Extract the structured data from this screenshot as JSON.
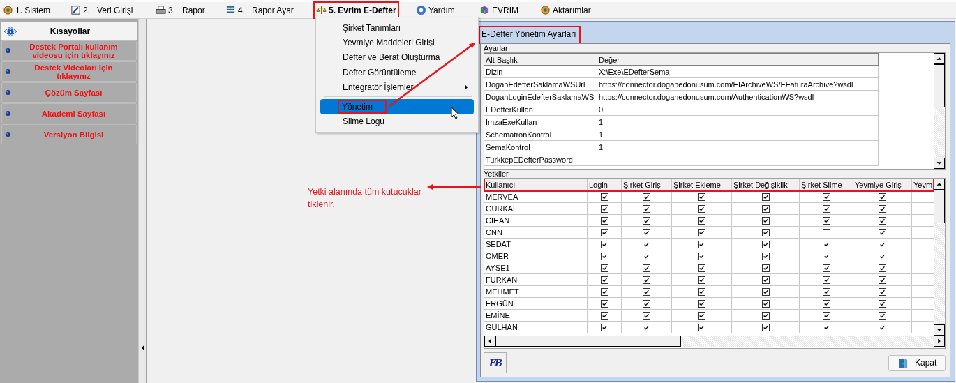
{
  "menu_bar": [
    {
      "label": "1. Sistem",
      "selected": false,
      "highlighted": false
    },
    {
      "label": "2.   Veri Girişi",
      "selected": false,
      "highlighted": false
    },
    {
      "label": "3.   Rapor",
      "selected": false,
      "highlighted": false
    },
    {
      "label": "4.   Rapor Ayar",
      "selected": false,
      "highlighted": false
    },
    {
      "label": "5. Evrim E-Defter",
      "selected": true,
      "highlighted": true
    },
    {
      "label": "Yardım",
      "selected": false,
      "highlighted": false
    },
    {
      "label": "EVRIM",
      "selected": false,
      "highlighted": false
    },
    {
      "label": "Aktarımlar",
      "selected": false,
      "highlighted": false
    }
  ],
  "dropdown": [
    {
      "kind": "item",
      "label": "Şirket Tanımları",
      "selected": false,
      "submenu": false,
      "highlighted": false
    },
    {
      "kind": "item",
      "label": "Yevmiye Maddeleri Girişi",
      "selected": false,
      "submenu": false,
      "highlighted": false
    },
    {
      "kind": "item",
      "label": "Defter ve Berat Oluşturma",
      "selected": false,
      "submenu": false,
      "highlighted": false
    },
    {
      "kind": "item",
      "label": "Defter Görüntüleme",
      "selected": false,
      "submenu": false,
      "highlighted": false
    },
    {
      "kind": "item",
      "label": "Entegratör İşlemleri",
      "selected": false,
      "submenu": true,
      "highlighted": false
    },
    {
      "kind": "separator"
    },
    {
      "kind": "item",
      "label": "Yönetim",
      "selected": true,
      "submenu": false,
      "highlighted": true
    },
    {
      "kind": "item",
      "label": "Silme Logu",
      "selected": false,
      "submenu": false,
      "highlighted": false
    }
  ],
  "sidebar": {
    "title": "Kısayollar",
    "items": [
      "Destek Portalı kullanım videosu için tıklayınız",
      "Destek Videoları için tıklayınız",
      "Çözüm Sayfası",
      "Akademi Sayfası",
      "Versiyon Bilgisi"
    ]
  },
  "dialog": {
    "title": "E-Defter Yönetim Ayarları",
    "title_highlighted": true,
    "settings": {
      "label": "Ayarlar",
      "columns": [
        "Alt Başlık",
        "Değer"
      ],
      "rows": [
        {
          "name": "Dizin",
          "value": "X:\\Exe\\EDefterSema"
        },
        {
          "name": "DoganEdefterSaklamaWSUrl",
          "value": "https://connector.doganedonusum.com/EIArchiveWS/EFaturaArchive?wsdl"
        },
        {
          "name": "DoganLoginEdefterSaklamaWS",
          "value": "https://connector.doganedonusum.com/AuthenticationWS?wsdl"
        },
        {
          "name": "EDefterKullan",
          "value": "0"
        },
        {
          "name": "ImzaExeKullan",
          "value": "1"
        },
        {
          "name": "SchematronKontrol",
          "value": "1"
        },
        {
          "name": "SemaKontrol",
          "value": "1"
        },
        {
          "name": "TurkkepEDefterPassword"
        }
      ]
    },
    "permissions": {
      "label": "Yetkiler",
      "header_highlighted": true,
      "columns": [
        "Kullanıcı",
        "Login",
        "Şirket Giriş",
        "Şirket Ekleme",
        "Şirket Değişiklik",
        "Şirket Silme",
        "Yevmiye Giriş",
        "Yevm"
      ],
      "rows": [
        {
          "user": "MERVEA",
          "checks": [
            true,
            true,
            true,
            true,
            true,
            true
          ]
        },
        {
          "user": "GURKAL",
          "checks": [
            true,
            true,
            true,
            true,
            true,
            true
          ]
        },
        {
          "user": "CIHAN",
          "checks": [
            true,
            true,
            true,
            true,
            true,
            true
          ]
        },
        {
          "user": "CNN",
          "checks": [
            true,
            true,
            true,
            true,
            false,
            true
          ]
        },
        {
          "user": "SEDAT",
          "checks": [
            true,
            true,
            true,
            true,
            true,
            true
          ]
        },
        {
          "user": "ÖMER",
          "checks": [
            true,
            true,
            true,
            true,
            true,
            true
          ]
        },
        {
          "user": "AYSE1",
          "checks": [
            true,
            true,
            true,
            true,
            true,
            true
          ]
        },
        {
          "user": "FURKAN",
          "checks": [
            true,
            true,
            true,
            true,
            true,
            true
          ]
        },
        {
          "user": "MEHMET",
          "checks": [
            true,
            true,
            true,
            true,
            true,
            true
          ]
        },
        {
          "user": "ERGÜN",
          "checks": [
            true,
            true,
            true,
            true,
            true,
            true
          ]
        },
        {
          "user": "EMİNE",
          "checks": [
            true,
            true,
            true,
            true,
            true,
            true
          ]
        },
        {
          "user": "GULHAN",
          "checks": [
            true,
            true,
            true,
            true,
            true,
            true
          ]
        }
      ]
    },
    "logo": "EB",
    "close_button": "Kapat"
  },
  "callout": {
    "text": "Yetki alanında tüm kutucuklar tiklenir."
  }
}
